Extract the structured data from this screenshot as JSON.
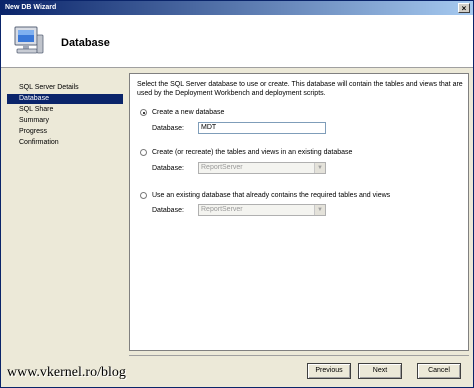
{
  "window": {
    "title": "New DB Wizard",
    "close_glyph": "×"
  },
  "header": {
    "title": "Database",
    "icon": "computer-icon"
  },
  "sidebar": {
    "items": [
      {
        "label": "SQL Server Details",
        "selected": false
      },
      {
        "label": "Database",
        "selected": true
      },
      {
        "label": "SQL Share",
        "selected": false
      },
      {
        "label": "Summary",
        "selected": false
      },
      {
        "label": "Progress",
        "selected": false
      },
      {
        "label": "Confirmation",
        "selected": false
      }
    ]
  },
  "content": {
    "description": "Select the SQL Server database to use or create.  This database will contain the tables and views that are used by the Deployment Workbench and deployment scripts.",
    "options": [
      {
        "label": "Create a new database",
        "checked": true,
        "field_label": "Database:",
        "value": "MDT",
        "enabled": true
      },
      {
        "label": "Create (or recreate) the tables and views in an existing database",
        "checked": false,
        "field_label": "Database:",
        "value": "ReportServer",
        "enabled": false
      },
      {
        "label": "Use an existing database that already contains the required tables and views",
        "checked": false,
        "field_label": "Database:",
        "value": "ReportServer",
        "enabled": false
      }
    ]
  },
  "buttons": {
    "previous": "Previous",
    "next": "Next",
    "cancel": "Cancel"
  },
  "watermark": "www.vkernel.ro/blog",
  "colors": {
    "titlebar_start": "#0a246a",
    "titlebar_end": "#a6caf0",
    "selection": "#0a246a"
  }
}
